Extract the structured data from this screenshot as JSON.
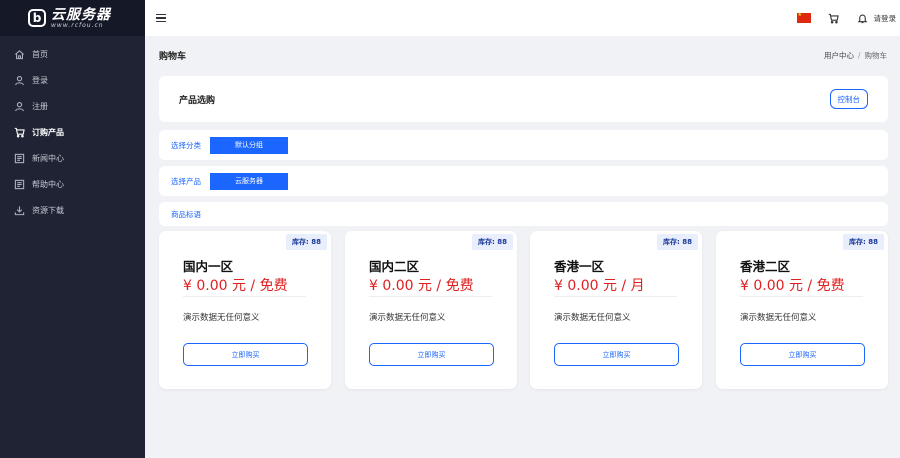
{
  "brand": {
    "title": "云服务器",
    "subtitle": "www.rcfou.cn",
    "mark": "b"
  },
  "sidebar": {
    "items": [
      {
        "label": "首页",
        "icon": "home-icon",
        "active": false
      },
      {
        "label": "登录",
        "icon": "user-icon",
        "active": false
      },
      {
        "label": "注册",
        "icon": "user-add-icon",
        "active": false
      },
      {
        "label": "订购产品",
        "icon": "cart-icon",
        "active": true
      },
      {
        "label": "新闻中心",
        "icon": "news-icon",
        "active": false
      },
      {
        "label": "帮助中心",
        "icon": "help-icon",
        "active": false
      },
      {
        "label": "资源下载",
        "icon": "download-icon",
        "active": false
      }
    ]
  },
  "topbar": {
    "login_label": "请登录",
    "flag": "china-flag-icon"
  },
  "page": {
    "title": "购物车",
    "breadcrumb": [
      "用户中心",
      "购物车"
    ]
  },
  "product_panel": {
    "title": "产品选购",
    "console_label": "控制台"
  },
  "filters": {
    "category_label": "选择分类",
    "category_value": "默认分组",
    "product_label": "选择产品",
    "product_value": "云服务器",
    "tag_label": "商品标语"
  },
  "cards": [
    {
      "stock": "库存: 88",
      "name": "国内一区",
      "price": "¥ 0.00 元 / 免费",
      "desc": "演示数据无任何意义",
      "buy_label": "立即购买"
    },
    {
      "stock": "库存: 88",
      "name": "国内二区",
      "price": "¥ 0.00 元 / 免费",
      "desc": "演示数据无任何意义",
      "buy_label": "立即购买"
    },
    {
      "stock": "库存: 88",
      "name": "香港一区",
      "price": "¥ 0.00 元 / 月",
      "desc": "演示数据无任何意义",
      "buy_label": "立即购买"
    },
    {
      "stock": "库存: 88",
      "name": "香港二区",
      "price": "¥ 0.00 元 / 免费",
      "desc": "演示数据无任何意义",
      "buy_label": "立即购买"
    }
  ],
  "colors": {
    "accent": "#1a66ff",
    "sidebar": "#1f2333",
    "price": "#e02020"
  }
}
